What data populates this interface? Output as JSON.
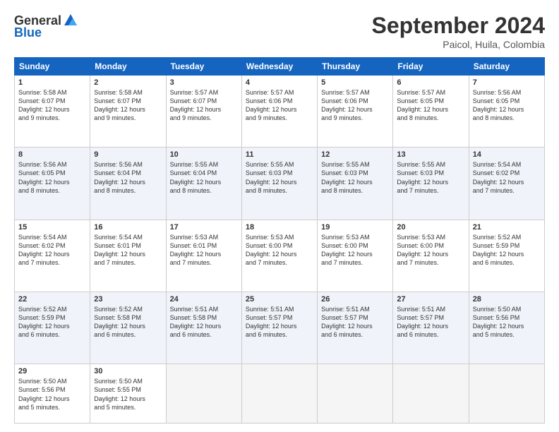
{
  "header": {
    "logo_general": "General",
    "logo_blue": "Blue",
    "title": "September 2024",
    "subtitle": "Paicol, Huila, Colombia"
  },
  "columns": [
    "Sunday",
    "Monday",
    "Tuesday",
    "Wednesday",
    "Thursday",
    "Friday",
    "Saturday"
  ],
  "weeks": [
    [
      {
        "day": "1",
        "detail": "Sunrise: 5:58 AM\nSunset: 6:07 PM\nDaylight: 12 hours\nand 9 minutes."
      },
      {
        "day": "2",
        "detail": "Sunrise: 5:58 AM\nSunset: 6:07 PM\nDaylight: 12 hours\nand 9 minutes."
      },
      {
        "day": "3",
        "detail": "Sunrise: 5:57 AM\nSunset: 6:07 PM\nDaylight: 12 hours\nand 9 minutes."
      },
      {
        "day": "4",
        "detail": "Sunrise: 5:57 AM\nSunset: 6:06 PM\nDaylight: 12 hours\nand 9 minutes."
      },
      {
        "day": "5",
        "detail": "Sunrise: 5:57 AM\nSunset: 6:06 PM\nDaylight: 12 hours\nand 9 minutes."
      },
      {
        "day": "6",
        "detail": "Sunrise: 5:57 AM\nSunset: 6:05 PM\nDaylight: 12 hours\nand 8 minutes."
      },
      {
        "day": "7",
        "detail": "Sunrise: 5:56 AM\nSunset: 6:05 PM\nDaylight: 12 hours\nand 8 minutes."
      }
    ],
    [
      {
        "day": "8",
        "detail": "Sunrise: 5:56 AM\nSunset: 6:05 PM\nDaylight: 12 hours\nand 8 minutes."
      },
      {
        "day": "9",
        "detail": "Sunrise: 5:56 AM\nSunset: 6:04 PM\nDaylight: 12 hours\nand 8 minutes."
      },
      {
        "day": "10",
        "detail": "Sunrise: 5:55 AM\nSunset: 6:04 PM\nDaylight: 12 hours\nand 8 minutes."
      },
      {
        "day": "11",
        "detail": "Sunrise: 5:55 AM\nSunset: 6:03 PM\nDaylight: 12 hours\nand 8 minutes."
      },
      {
        "day": "12",
        "detail": "Sunrise: 5:55 AM\nSunset: 6:03 PM\nDaylight: 12 hours\nand 8 minutes."
      },
      {
        "day": "13",
        "detail": "Sunrise: 5:55 AM\nSunset: 6:03 PM\nDaylight: 12 hours\nand 7 minutes."
      },
      {
        "day": "14",
        "detail": "Sunrise: 5:54 AM\nSunset: 6:02 PM\nDaylight: 12 hours\nand 7 minutes."
      }
    ],
    [
      {
        "day": "15",
        "detail": "Sunrise: 5:54 AM\nSunset: 6:02 PM\nDaylight: 12 hours\nand 7 minutes."
      },
      {
        "day": "16",
        "detail": "Sunrise: 5:54 AM\nSunset: 6:01 PM\nDaylight: 12 hours\nand 7 minutes."
      },
      {
        "day": "17",
        "detail": "Sunrise: 5:53 AM\nSunset: 6:01 PM\nDaylight: 12 hours\nand 7 minutes."
      },
      {
        "day": "18",
        "detail": "Sunrise: 5:53 AM\nSunset: 6:00 PM\nDaylight: 12 hours\nand 7 minutes."
      },
      {
        "day": "19",
        "detail": "Sunrise: 5:53 AM\nSunset: 6:00 PM\nDaylight: 12 hours\nand 7 minutes."
      },
      {
        "day": "20",
        "detail": "Sunrise: 5:53 AM\nSunset: 6:00 PM\nDaylight: 12 hours\nand 7 minutes."
      },
      {
        "day": "21",
        "detail": "Sunrise: 5:52 AM\nSunset: 5:59 PM\nDaylight: 12 hours\nand 6 minutes."
      }
    ],
    [
      {
        "day": "22",
        "detail": "Sunrise: 5:52 AM\nSunset: 5:59 PM\nDaylight: 12 hours\nand 6 minutes."
      },
      {
        "day": "23",
        "detail": "Sunrise: 5:52 AM\nSunset: 5:58 PM\nDaylight: 12 hours\nand 6 minutes."
      },
      {
        "day": "24",
        "detail": "Sunrise: 5:51 AM\nSunset: 5:58 PM\nDaylight: 12 hours\nand 6 minutes."
      },
      {
        "day": "25",
        "detail": "Sunrise: 5:51 AM\nSunset: 5:57 PM\nDaylight: 12 hours\nand 6 minutes."
      },
      {
        "day": "26",
        "detail": "Sunrise: 5:51 AM\nSunset: 5:57 PM\nDaylight: 12 hours\nand 6 minutes."
      },
      {
        "day": "27",
        "detail": "Sunrise: 5:51 AM\nSunset: 5:57 PM\nDaylight: 12 hours\nand 6 minutes."
      },
      {
        "day": "28",
        "detail": "Sunrise: 5:50 AM\nSunset: 5:56 PM\nDaylight: 12 hours\nand 5 minutes."
      }
    ],
    [
      {
        "day": "29",
        "detail": "Sunrise: 5:50 AM\nSunset: 5:56 PM\nDaylight: 12 hours\nand 5 minutes."
      },
      {
        "day": "30",
        "detail": "Sunrise: 5:50 AM\nSunset: 5:55 PM\nDaylight: 12 hours\nand 5 minutes."
      },
      {
        "day": "",
        "detail": ""
      },
      {
        "day": "",
        "detail": ""
      },
      {
        "day": "",
        "detail": ""
      },
      {
        "day": "",
        "detail": ""
      },
      {
        "day": "",
        "detail": ""
      }
    ]
  ]
}
